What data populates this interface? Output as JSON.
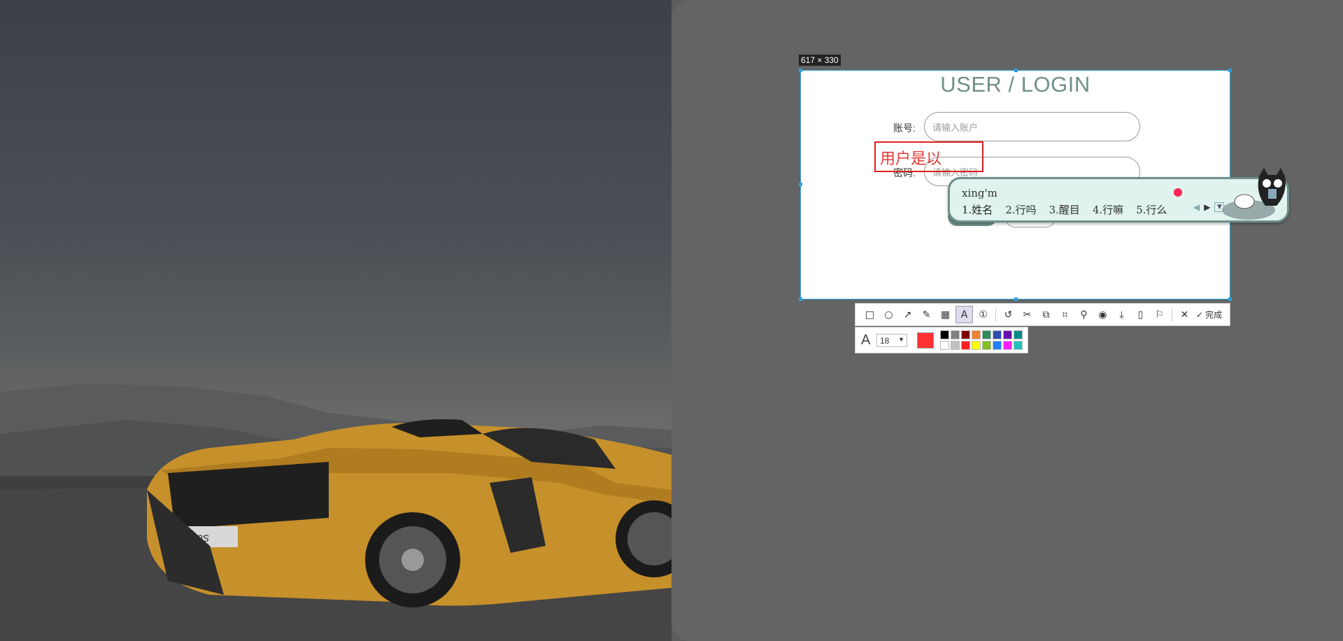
{
  "selection": {
    "size_label": "617 × 330"
  },
  "login": {
    "title": "USER / LOGIN",
    "account_label": "账号:",
    "account_placeholder": "请输入账户",
    "password_label": "密码:",
    "password_placeholder": "请输入密码"
  },
  "annotation": {
    "text": "用户是以",
    "color": "#e53935"
  },
  "ime": {
    "composition": "xing'm",
    "candidates": [
      "1.姓名",
      "2.行吗",
      "3.醒目",
      "4.行嘛",
      "5.行么"
    ]
  },
  "toolbar": {
    "tools": [
      "rectangle-icon",
      "ellipse-icon",
      "arrow-icon",
      "pen-icon",
      "mosaic-icon",
      "text-icon",
      "number-icon",
      "undo-icon",
      "cut-icon",
      "ocr-icon",
      "scan-icon",
      "pin-icon",
      "record-icon",
      "download-icon",
      "save-icon",
      "bookmark-icon",
      "close-icon"
    ],
    "done_label": "完成"
  },
  "text_options": {
    "font_size": "18",
    "current_color": "#ff3333",
    "palette": [
      "#000000",
      "#808080",
      "#800000",
      "#f08030",
      "#2e8b57",
      "#2f4fb0",
      "#6a0dad",
      "#008b8b",
      "#ffffff",
      "#c0c0c0",
      "#ff2020",
      "#ffff00",
      "#80c020",
      "#2080ff",
      "#ff20ff",
      "#20c0c0"
    ]
  }
}
